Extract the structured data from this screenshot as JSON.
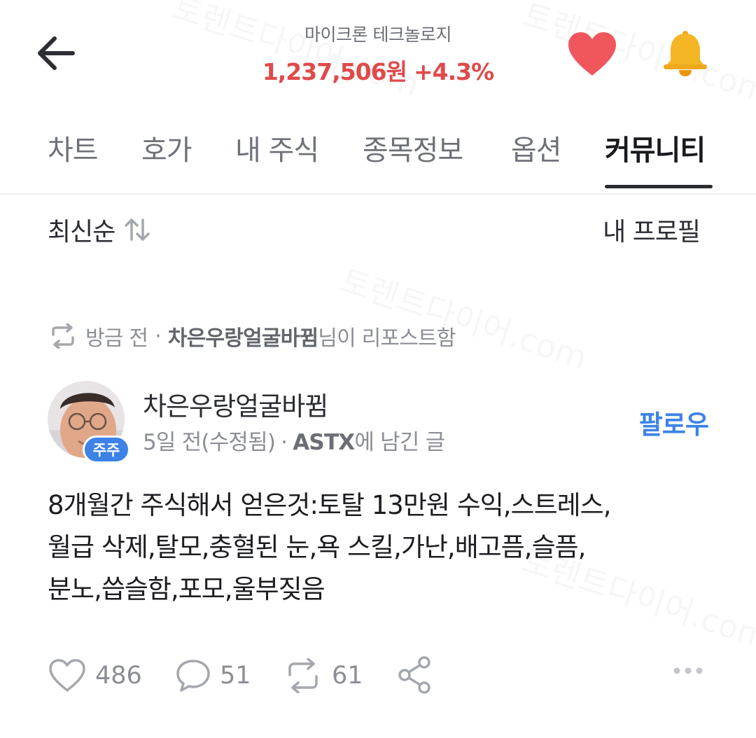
{
  "header": {
    "stock_name": "마이크론 테크놀로지",
    "price": "1,237,506원",
    "change": "+4.3%",
    "price_color": "#e04a4a",
    "icons": [
      "back-arrow-icon",
      "heart-icon",
      "bell-icon"
    ]
  },
  "tabs": [
    {
      "label": "차트",
      "active": false
    },
    {
      "label": "호가",
      "active": false
    },
    {
      "label": "내 주식",
      "active": false
    },
    {
      "label": "종목정보",
      "active": false
    },
    {
      "label": "옵션",
      "active": false
    },
    {
      "label": "커뮤니티",
      "active": true
    }
  ],
  "sort": {
    "label": "최신순",
    "profile_label": "내 프로필"
  },
  "repost_note": {
    "time": "방금 전",
    "separator": "·",
    "user": "차은우랑얼굴바뀜",
    "suffix": "님이 리포스트함"
  },
  "post": {
    "author": "차은우랑얼굴바뀜",
    "badge": "주주",
    "meta_time": "5일 전(수정됨)",
    "meta_sep": "·",
    "meta_ticker": "ASTX",
    "meta_suffix": "에 남긴 글",
    "follow_label": "팔로우",
    "body_lines": [
      "8개월간 주식해서 얻은것:토탈 13만원 수익,스트레스,",
      "월급 삭제,탈모,충혈된 눈,욕 스킬,가난,배고픔,슬픔,",
      "분노,씁슬함,포모,울부짖음"
    ],
    "likes": "486",
    "comments": "51",
    "reposts": "61"
  },
  "watermark_text": "토렌트다이어.com",
  "colors": {
    "accent": "#3d82e6",
    "up": "#e04a4a",
    "heart": "#f0575c",
    "bell": "#f5b625"
  }
}
